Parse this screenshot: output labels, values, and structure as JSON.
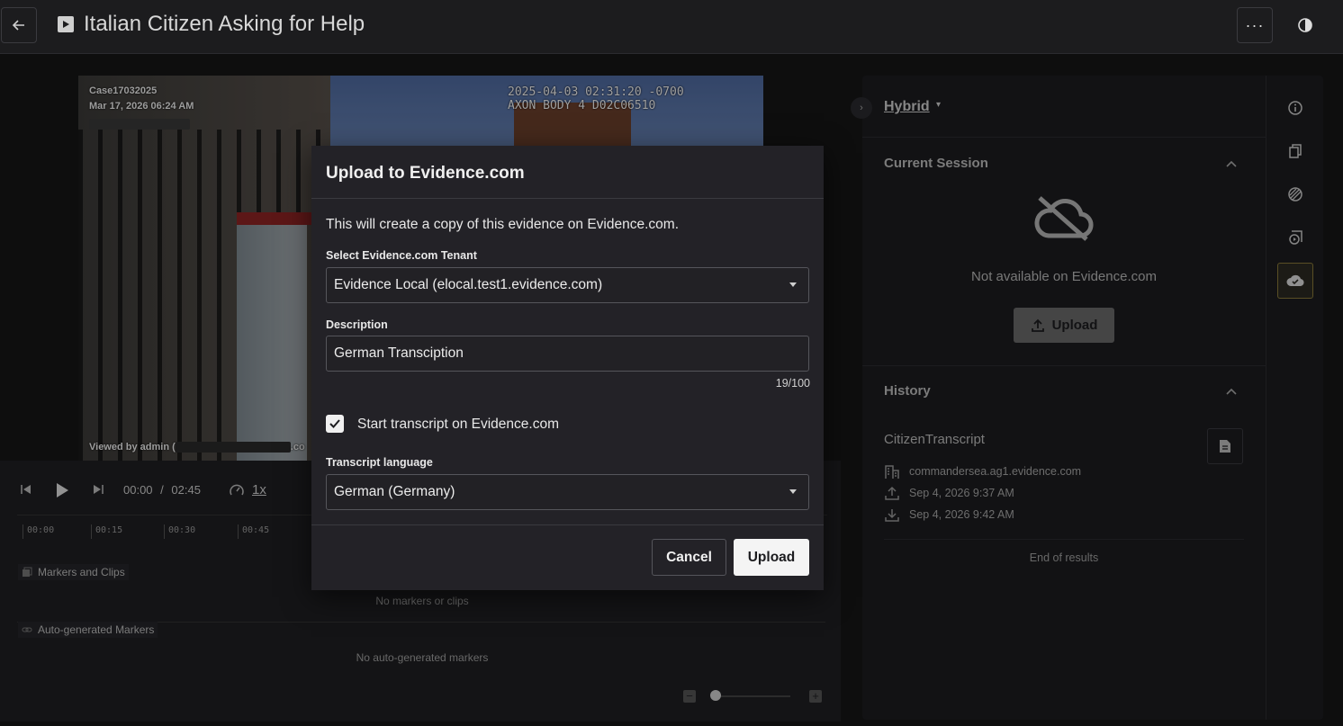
{
  "header": {
    "title": "Italian Citizen Asking for Help"
  },
  "video": {
    "case_id": "Case17032025",
    "date": "Mar 17, 2026 06:24 AM",
    "camera_stamp_line1": "2025-04-03 02:31:20 -0700",
    "camera_stamp_line2": "AXON BODY 4 D02C06510",
    "viewed_by_prefix": "Viewed by admin (",
    "viewed_by_suffix": ".co"
  },
  "player": {
    "current_time": "00:00",
    "separator": "/",
    "duration": "02:45",
    "speed": "1x",
    "ticks": [
      "00:00",
      "00:15",
      "00:30",
      "00:45"
    ],
    "tracks": {
      "markers_label": "Markers and Clips",
      "markers_empty": "No markers or clips",
      "auto_label": "Auto-generated Markers",
      "auto_empty": "No auto-generated markers"
    }
  },
  "side_panel": {
    "mode": "Hybrid",
    "current_session": {
      "title": "Current Session",
      "status": "Not available on Evidence.com",
      "upload_label": "Upload"
    },
    "history": {
      "title": "History",
      "entry_name": "CitizenTranscript",
      "tenant": "commandersea.ag1.evidence.com",
      "uploaded": "Sep 4, 2026 9:37 AM",
      "downloaded": "Sep 4, 2026 9:42 AM",
      "end_text": "End of results"
    }
  },
  "modal": {
    "title": "Upload to Evidence.com",
    "description": "This will create a copy of this evidence on Evidence.com.",
    "tenant_label": "Select Evidence.com Tenant",
    "tenant_value": "Evidence Local (elocal.test1.evidence.com)",
    "description_label": "Description",
    "description_value": "German Transciption",
    "char_count": "19/100",
    "transcript_checkbox_label": "Start transcript on Evidence.com",
    "transcript_checked": true,
    "language_label": "Transcript language",
    "language_value": "German (Germany)",
    "cancel_label": "Cancel",
    "upload_label": "Upload"
  },
  "colors": {
    "background": "#161616",
    "panel": "#1c1c1f",
    "modal": "#232227",
    "active_rail": "#8a7a3a"
  }
}
